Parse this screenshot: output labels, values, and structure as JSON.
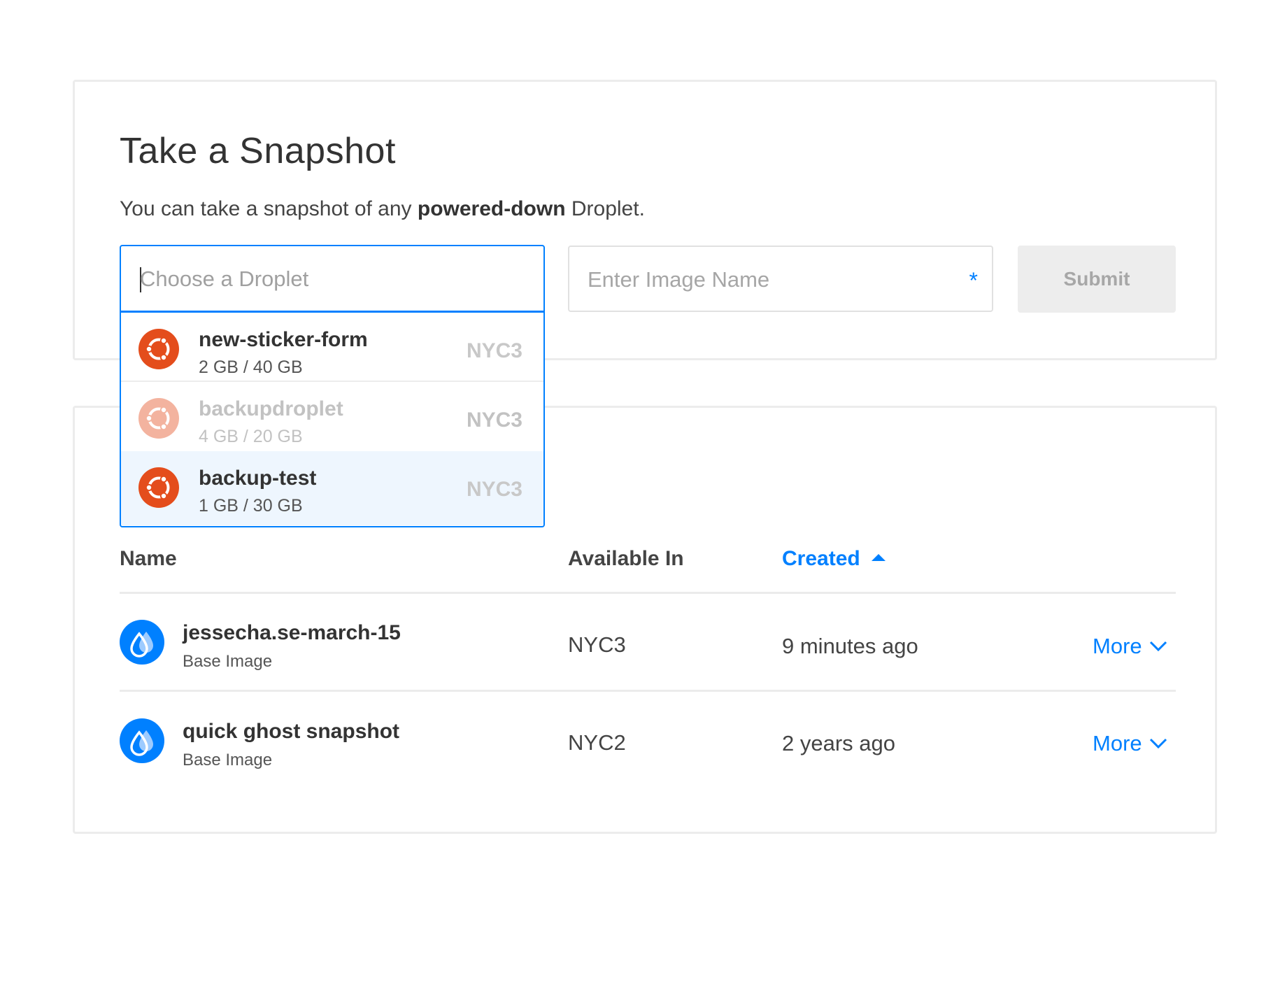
{
  "snapshot_form": {
    "title": "Take a Snapshot",
    "description_prefix": "You can take a snapshot of any ",
    "description_bold": "powered-down",
    "description_suffix": " Droplet.",
    "droplet_placeholder": "Choose a Droplet",
    "image_name_placeholder": "Enter Image Name",
    "required_marker": "*",
    "submit_label": "Submit"
  },
  "droplet_options": [
    {
      "name": "new-sticker-form",
      "size": "2 GB / 40 GB",
      "region": "NYC3",
      "disabled": false,
      "highlighted": false,
      "icon": "ubuntu-icon"
    },
    {
      "name": "backupdroplet",
      "size": "4 GB / 20 GB",
      "region": "NYC3",
      "disabled": true,
      "highlighted": false,
      "icon": "ubuntu-icon"
    },
    {
      "name": "backup-test",
      "size": "1 GB / 30 GB",
      "region": "NYC3",
      "disabled": false,
      "highlighted": true,
      "icon": "ubuntu-icon"
    }
  ],
  "snapshots_table": {
    "columns": {
      "name": "Name",
      "available_in": "Available In",
      "created": "Created"
    },
    "sort": {
      "column": "created",
      "direction": "ascending"
    },
    "rows": [
      {
        "name": "jessecha.se-march-15",
        "type": "Base Image",
        "region": "NYC3",
        "created": "9 minutes ago",
        "action": "More",
        "icon": "snapshot-drop-icon"
      },
      {
        "name": "quick ghost snapshot",
        "type": "Base Image",
        "region": "NYC2",
        "created": "2 years ago",
        "action": "More",
        "icon": "snapshot-drop-icon"
      }
    ]
  },
  "colors": {
    "accent": "#0080ff",
    "ubuntu": "#e44d1c",
    "highlight": "#eef6fe"
  }
}
